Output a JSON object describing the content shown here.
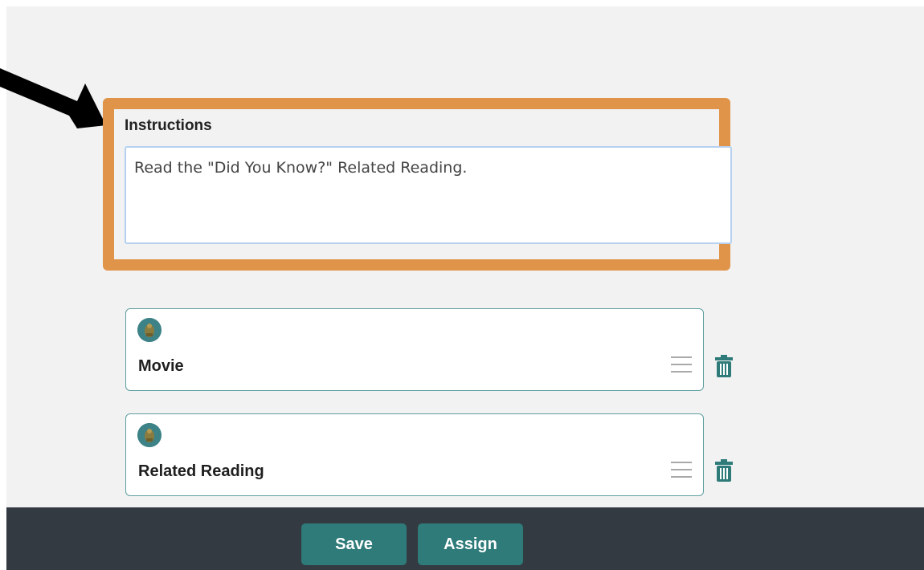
{
  "instructions": {
    "label": "Instructions",
    "value": "Read the \"Did You Know?\" Related Reading."
  },
  "items": [
    {
      "title": "Movie",
      "icon": "seal-icon"
    },
    {
      "title": "Related Reading",
      "icon": "seal-icon"
    }
  ],
  "footer": {
    "save_label": "Save",
    "assign_label": "Assign"
  },
  "colors": {
    "accent": "#2e7b79",
    "highlight": "#e0944a",
    "footer_bg": "#343a41",
    "card_border": "#5e9fa0"
  }
}
